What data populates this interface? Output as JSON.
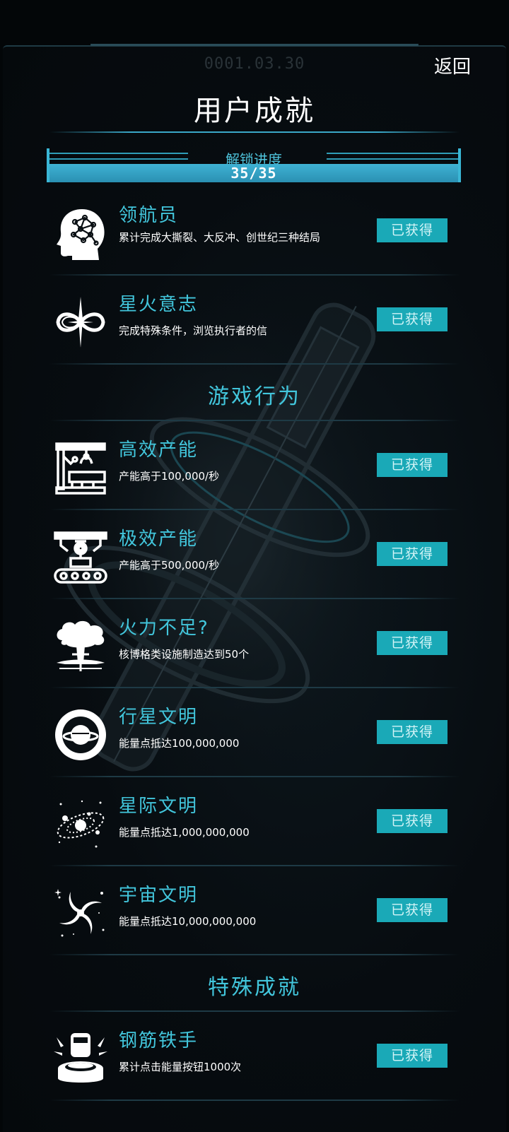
{
  "header": {
    "date": "0001.03.30",
    "back_label": "返回",
    "title": "用户成就"
  },
  "progress": {
    "label": "解锁进度",
    "text": "35/35",
    "unlocked": 35,
    "total": 35
  },
  "achievements_top": [
    {
      "name": "领航员",
      "desc": "累计完成大撕裂、大反冲、创世纪三种结局",
      "status": "已获得",
      "icon": "brain-head-icon"
    },
    {
      "name": "星火意志",
      "desc": "完成特殊条件，浏览执行者的信",
      "status": "已获得",
      "icon": "infinity-star-icon"
    }
  ],
  "section_behavior": {
    "title": "游戏行为",
    "items": [
      {
        "name": "高效产能",
        "desc": "产能高于100,000/秒",
        "status": "已获得",
        "icon": "factory-arm-icon"
      },
      {
        "name": "极效产能",
        "desc": "产能高于500,000/秒",
        "status": "已获得",
        "icon": "conveyor-robot-icon"
      },
      {
        "name": "火力不足?",
        "desc": "核博格类设施制造达到50个",
        "status": "已获得",
        "icon": "mushroom-cloud-icon"
      },
      {
        "name": "行星文明",
        "desc": "能量点抵达100,000,000",
        "status": "已获得",
        "icon": "planet-ring-icon"
      },
      {
        "name": "星际文明",
        "desc": "能量点抵达1,000,000,000",
        "status": "已获得",
        "icon": "solar-system-icon"
      },
      {
        "name": "宇宙文明",
        "desc": "能量点抵达10,000,000,000",
        "status": "已获得",
        "icon": "galaxy-spiral-icon"
      }
    ]
  },
  "section_special": {
    "title": "特殊成就",
    "items": [
      {
        "name": "钢筋铁手",
        "desc": "累计点击能量按钮1000次",
        "status": "已获得",
        "icon": "press-button-icon"
      }
    ]
  },
  "colors": {
    "accent": "#42c6dc",
    "badge_bg": "#1aa9b7",
    "background": "#05090c"
  }
}
